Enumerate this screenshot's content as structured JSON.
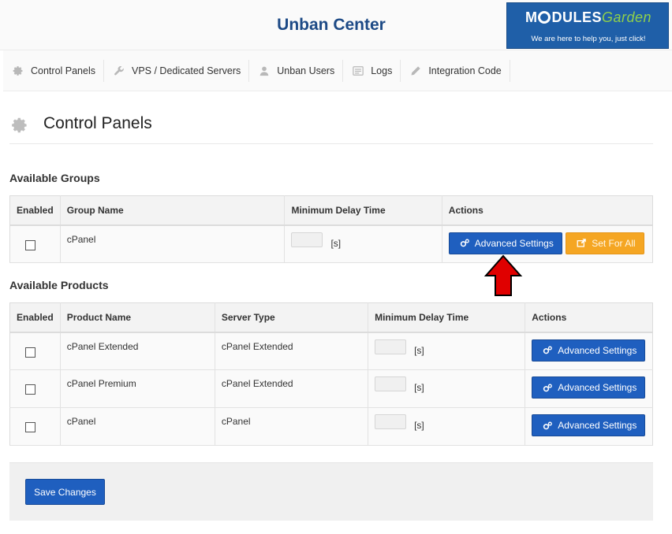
{
  "header": {
    "title": "Unban Center",
    "banner": {
      "logo_prefix": "M",
      "logo_mid": "DULES",
      "logo_suffix": "Garden",
      "tagline": "We are here to help you, just click!",
      "brand_color": "#1f5fa8",
      "accent_color": "#8fd04b"
    }
  },
  "nav": {
    "items": [
      {
        "label": "Control Panels",
        "icon": "gear-icon"
      },
      {
        "label": "VPS / Dedicated Servers",
        "icon": "wrench-icon"
      },
      {
        "label": "Unban Users",
        "icon": "user-icon"
      },
      {
        "label": "Logs",
        "icon": "list-icon"
      },
      {
        "label": "Integration Code",
        "icon": "pencil-icon"
      }
    ]
  },
  "page": {
    "title": "Control Panels",
    "title_icon": "gear-icon"
  },
  "groups": {
    "heading": "Available Groups",
    "columns": [
      "Enabled",
      "Group Name",
      "Minimum Delay Time",
      "Actions"
    ],
    "rows": [
      {
        "enabled": false,
        "name": "cPanel",
        "delay": "",
        "unit": "[s]"
      }
    ],
    "advanced_label": "Advanced Settings",
    "set_all_label": "Set For All"
  },
  "products": {
    "heading": "Available Products",
    "columns": [
      "Enabled",
      "Product Name",
      "Server Type",
      "Minimum Delay Time",
      "Actions"
    ],
    "rows": [
      {
        "enabled": false,
        "name": "cPanel Extended",
        "server_type": "cPanel Extended",
        "delay": "",
        "unit": "[s]"
      },
      {
        "enabled": false,
        "name": "cPanel Premium",
        "server_type": "cPanel Extended",
        "delay": "",
        "unit": "[s]"
      },
      {
        "enabled": false,
        "name": "cPanel",
        "server_type": "cPanel",
        "delay": "",
        "unit": "[s]"
      }
    ],
    "advanced_label": "Advanced Settings"
  },
  "footer": {
    "save_label": "Save Changes"
  },
  "colors": {
    "primary_button": "#1f5fbf",
    "warning_button": "#f5a623",
    "annotation_arrow": "#e00000"
  }
}
